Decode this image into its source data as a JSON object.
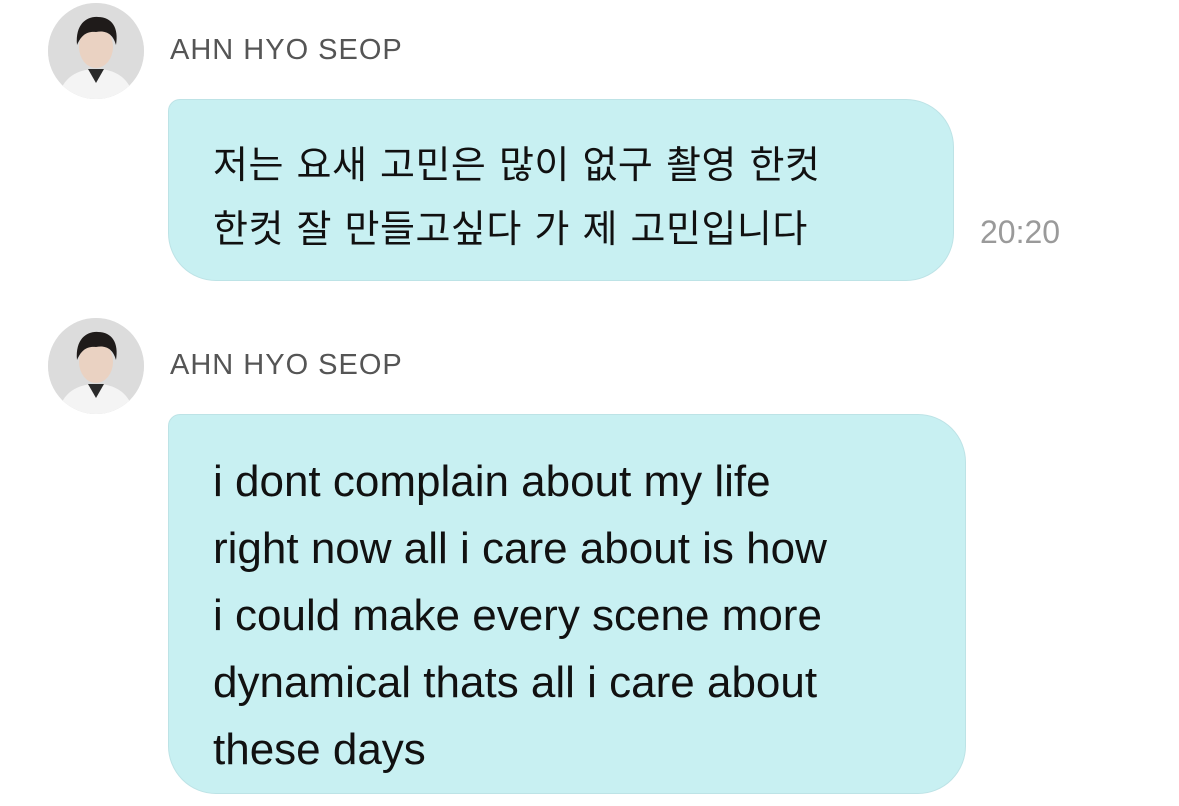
{
  "messages": [
    {
      "sender": "AHN HYO SEOP",
      "avatar_icon": "profile-photo",
      "text": "저는 요새 고민은 많이 없구 촬영 한컷\n한컷 잘 만들고싶다 가 제 고민입니다",
      "time": "20:20"
    },
    {
      "sender": "AHN HYO SEOP",
      "avatar_icon": "profile-photo",
      "text": "i dont complain about my life\nright now all i care about is how\ni could make every scene more\ndynamical thats all i care about\nthese days"
    }
  ],
  "colors": {
    "bubble": "#c8f0f2",
    "bubble_border": "#bde3e6",
    "sender_text": "#555555",
    "time_text": "#9a9a9a",
    "message_text": "#111111"
  }
}
